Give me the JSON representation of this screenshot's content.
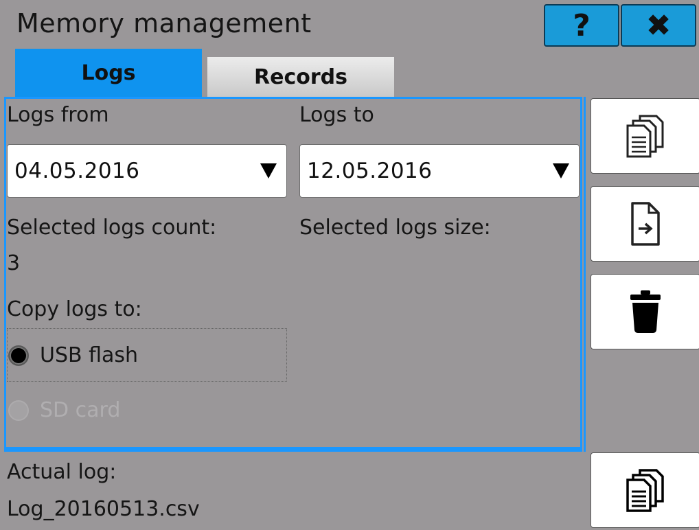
{
  "header": {
    "title": "Memory management",
    "help_label": "?",
    "close_label": "✖"
  },
  "tabs": [
    {
      "label": "Logs",
      "active": true
    },
    {
      "label": "Records",
      "active": false
    }
  ],
  "logs": {
    "from_label": "Logs from",
    "from_value": "04.05.2016",
    "to_label": "Logs to",
    "to_value": "12.05.2016",
    "count_label": "Selected logs count:",
    "count_value": "3",
    "size_label": "Selected logs size:",
    "size_value": "",
    "copy_label": "Copy logs to:",
    "options": [
      {
        "label": "USB flash",
        "selected": true,
        "enabled": true
      },
      {
        "label": "SD card",
        "selected": false,
        "enabled": false
      }
    ]
  },
  "actual_log": {
    "label": "Actual log:",
    "value": "Log_20160513.csv"
  },
  "side_buttons": [
    {
      "icon": "copy-documents-icon"
    },
    {
      "icon": "file-export-icon"
    },
    {
      "icon": "trash-icon"
    },
    {
      "icon": "copy-actual-log-icon"
    }
  ],
  "colors": {
    "background": "#9a9799",
    "accent": "#0f93ef",
    "header_button": "#1a9bd8"
  }
}
